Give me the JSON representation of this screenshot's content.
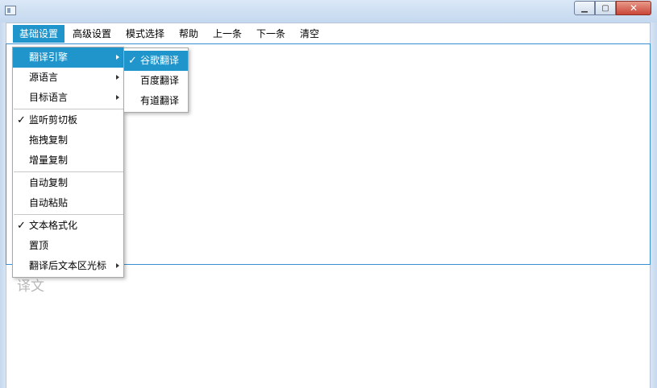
{
  "window": {
    "title": ""
  },
  "menubar": {
    "items": [
      {
        "label": "基础设置",
        "active": true
      },
      {
        "label": "高级设置"
      },
      {
        "label": "模式选择"
      },
      {
        "label": "帮助"
      },
      {
        "label": "上一条"
      },
      {
        "label": "下一条"
      },
      {
        "label": "清空"
      }
    ]
  },
  "basic_menu": {
    "items": [
      {
        "label": "翻译引擎",
        "submenu": true,
        "highlighted": true
      },
      {
        "label": "源语言",
        "submenu": true
      },
      {
        "label": "目标语言",
        "submenu": true
      },
      {
        "label": "监听剪切板",
        "checked": true
      },
      {
        "label": "拖拽复制"
      },
      {
        "label": "增量复制"
      },
      {
        "label": "自动复制"
      },
      {
        "label": "自动粘贴"
      },
      {
        "label": "文本格式化",
        "checked": true
      },
      {
        "label": "置顶"
      },
      {
        "label": "翻译后文本区光标",
        "submenu": true
      }
    ]
  },
  "engine_submenu": {
    "items": [
      {
        "label": "谷歌翻译",
        "checked": true,
        "highlighted": true
      },
      {
        "label": "百度翻译"
      },
      {
        "label": "有道翻译"
      }
    ]
  },
  "target_area": {
    "placeholder": "译文"
  },
  "colors": {
    "accent": "#1f95cc",
    "frame": "#c6d8ee",
    "close": "#c9463a"
  },
  "icons": {
    "check": "check-icon",
    "submenu_arrow": "chevron-right-icon"
  }
}
